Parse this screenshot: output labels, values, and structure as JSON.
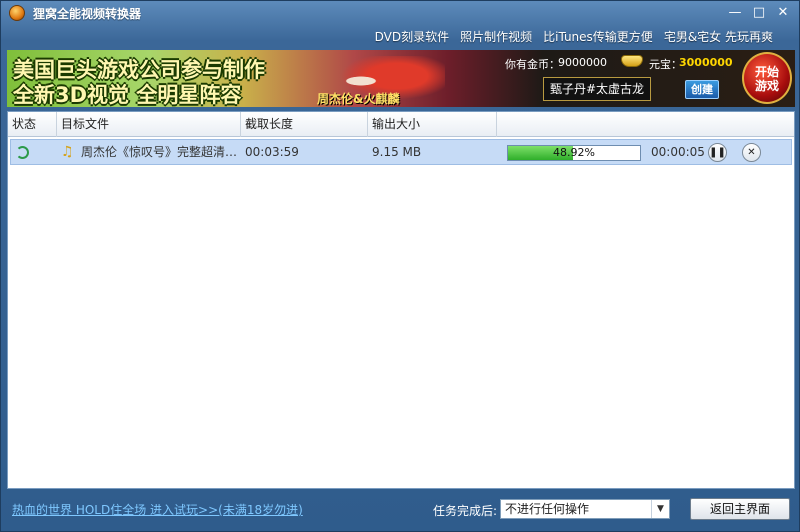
{
  "window": {
    "title": "狸窝全能视频转换器",
    "minimize": "—",
    "maximize": "□",
    "close": "✕"
  },
  "top_links": [
    "DVD刻录软件",
    "照片制作视频",
    "比iTunes传输更方便",
    "宅男&宅女 先玩再爽"
  ],
  "banner": {
    "line1": "美国巨头游戏公司参与制作",
    "line2": "全新3D视觉 全明星阵容",
    "caption": "周杰伦&火麒麟",
    "gold_label": "你有金币：",
    "gold_value": "9000000",
    "yuanbao_label": "元宝：",
    "yuanbao_value": "3000000",
    "character_name": "甄子丹#太虚古龙",
    "create_label": "创建",
    "start_label_1": "开始",
    "start_label_2": "游戏"
  },
  "table": {
    "columns": [
      "状态",
      "目标文件",
      "截取长度",
      "输出大小",
      ""
    ],
    "rows": [
      {
        "file": "周杰伦《惊叹号》完整超清…",
        "length": "00:03:59",
        "size": "9.15 MB",
        "progress_text": "48.92%",
        "progress": 0.4892,
        "remaining": "00:00:05"
      }
    ]
  },
  "footer": {
    "promo": "热血的世界 HOLD住全场 进入试玩>>(未满18岁勿进)",
    "after_label": "任务完成后:",
    "after_value": "不进行任何操作",
    "back_label": "返回主界面"
  }
}
